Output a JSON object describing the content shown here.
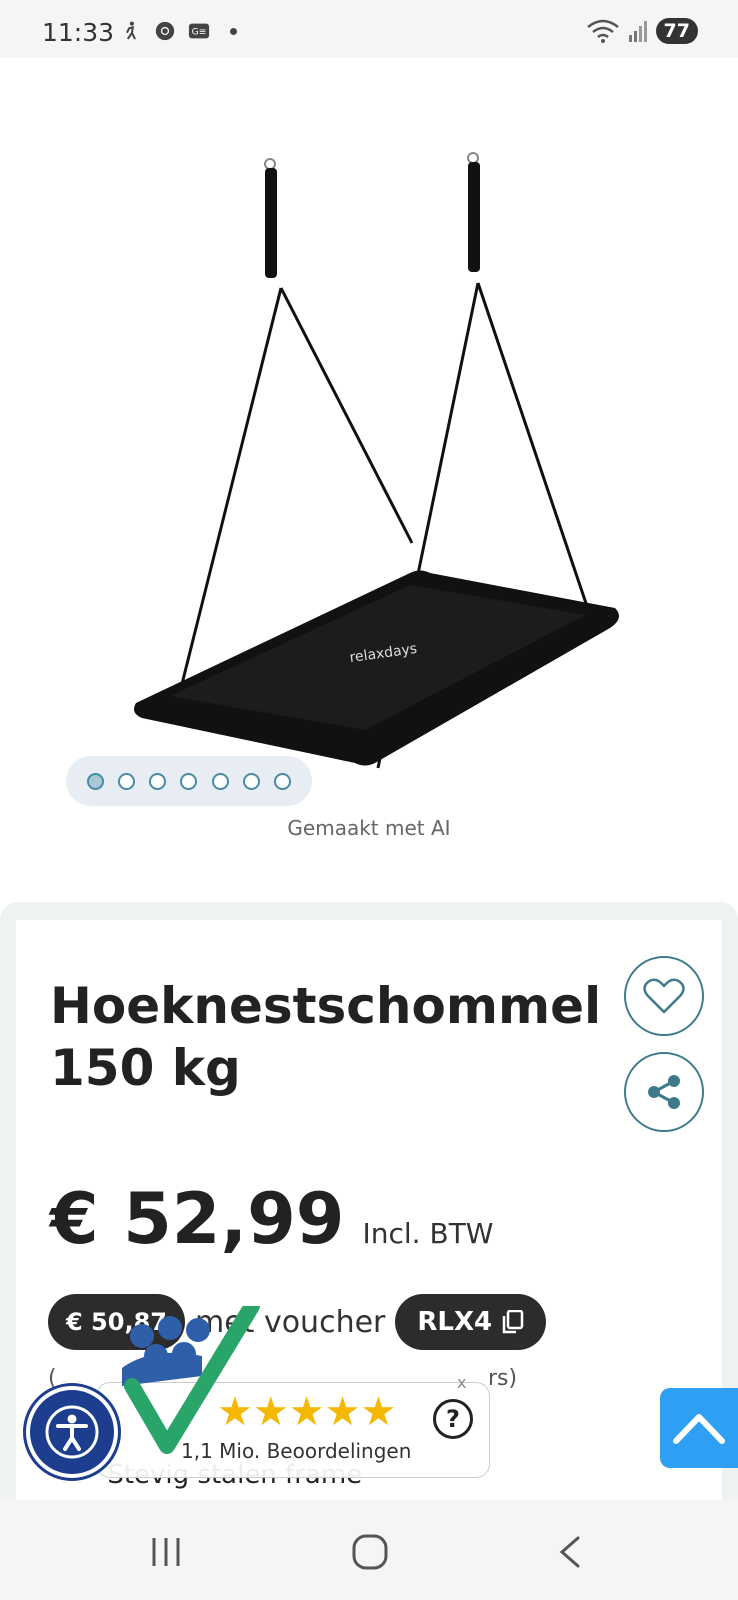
{
  "status_bar": {
    "time": "11:33",
    "battery": "77",
    "icons": [
      "walk-icon",
      "chrome-icon",
      "translate-icon",
      "wifi-icon",
      "signal-icon"
    ]
  },
  "gallery": {
    "dots_total": 7,
    "active_dot": 0,
    "ai_note": "Gemaakt met AI",
    "product_brand_text": "relaxdays"
  },
  "product": {
    "title": "Hoeknestschommel 150 kg",
    "price": "€ 52,99",
    "vat_note": "Incl. BTW",
    "voucher_price": "€ 50,87",
    "voucher_text": "met voucher",
    "voucher_code": "RLX4",
    "partial_line_left": "(",
    "partial_line_right": "rs)",
    "bullet_1": "Stevig stalen frame"
  },
  "review_widget": {
    "stars": "★★★★★",
    "count": "1,1 Mio. Beoordelingen",
    "help": "?",
    "close": "x"
  },
  "colors": {
    "accent": "#3e7a8a",
    "scroll_top": "#2e9ff2",
    "a11y": "#1d3d8f",
    "pill": "#2c2c2c",
    "stars": "#f4b800"
  }
}
